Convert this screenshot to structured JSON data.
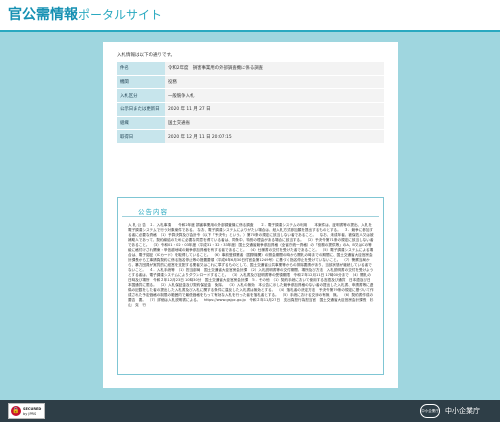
{
  "header": {
    "title_main": "官公需情報",
    "title_sub": "ポータルサイト"
  },
  "intro": "入札情報は以下の通りです。",
  "info_rows": [
    {
      "label": "件名",
      "value": "令和2年度　損害事業用の外部調査機に係る調査"
    },
    {
      "label": "機関",
      "value": "役務"
    },
    {
      "label": "入札区分",
      "value": "一般競争入札"
    },
    {
      "label": "公示日または更新日",
      "value": "2020 年 11 月 27 日"
    },
    {
      "label": "組織",
      "value": "国土交通省"
    },
    {
      "label": "取得日",
      "value": "2020 年 12 月 11 日 20:07:15"
    }
  ],
  "notice": {
    "title": "公告内容",
    "body": "入 札 公 告　１．入札事項　　令和2年度 損害事業用の外部調査機に係る調査　　２．電子調達システムの利用　　本案件は、証明書等の提出、入札を電子調達システムで行う対象案件である。 なお、電子調達システムによりがたい場合は、紙入札方式参加願を提出するものとする。　３．競争に参加する者に必要な資格　（1）予算決算及び会計令（以下「予決令」という。）第70条の規定に該当しない者であること。　なお、未成年者、被保佐人又は被補助人であって、契約締結のために必要な同意を得ている者は、同条中、特別の理由がある場合に該当する。　（2）予決令第71条の規定に該当しない者であること。　（3）令和01・02・03年度（平成31・32・33年度）国土交通省競争参加資格（全省庁統一資格）の「役務の提供等」のA、B又はCの等級に格付けされ関東・甲信越地域の競争参加資格を有する者であること。　（4）仕様書の交付を受けた者であること。　（5）電子調達システムによる場合は、電子認証（ICカード）を取得していること。　（6）事前登録業者（国際機関）の照会期間の時から開札の時までの期間に、国土交通省大臣官房会計課長から工事請負契約に係る指名停止等の措置要領（平成6年6月30日付官会第1249号）に基づく指名停止を受けていないこと。　（7）警察当局から、暴力団員が実質的に経営を支配する業者又はこれに準ずるものとして、国土交通省公共事業等からの排除要請があり、当該状態が継続している者でないこと。　４．入札手続等　（1）担当部局　国土交通省大臣官房会計課　（2）入札説明書等の交付期間、場所及び方法　入札説明書の交付を受けようとする者は、電子調達システムによりダウンロードすること。　（3）入札書及び証明書等の受領期限　令和２年12月11日 17時00分まで　（4）開札の日時及び場所　令和２年12月23日 10時30分　国土交通省大臣官房会計課　５．その他　（1）契約手続において使用する言語及び通貨　日本語及び日本国通貨に限る。　（2）入札保証金及び契約保証金　免除。　（3）入札の無効　本公告に示した競争参加資格のない者の提出した入札書、申請書等に虚偽の記載をした者の提出した入札書及び入札に関する条件に違反した入札書は無効とする。　（4）落札者の決定方法　予決令第79条の規定に基づいて作成された予定価格の制限の範囲内で最低価格をもって有効な入札を行った者を落札者とする。　（5）手続における交渉の有無　無。　（6）契約書作成の要否　要。　（7）詳細は入札説明書による。　https://www.gsjpc.go.jp　令和２年11月27日　支出負担行為担当官　国土交通省大臣官房会計課長　杉　山　克　行"
  },
  "footer": {
    "badge_line1": "SECURED",
    "badge_line2": "by JPRS",
    "agency_logo": "中小企業庁",
    "agency_name": "中小企業庁"
  }
}
